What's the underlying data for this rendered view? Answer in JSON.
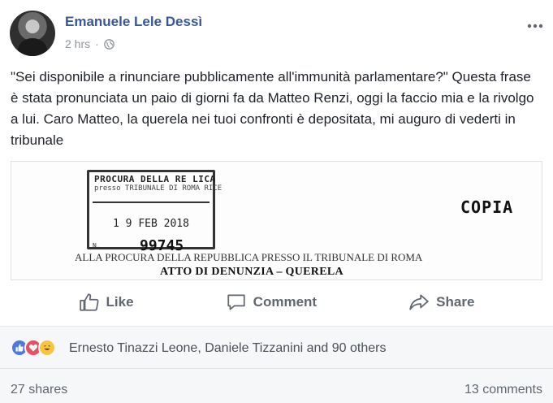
{
  "post": {
    "author": "Emanuele Lele Dessì",
    "time": "2 hrs",
    "dot": "·",
    "audience_icon": "globe-icon",
    "text": "\"Sei disponibile a rinunciare pubblicamente all'immunità parlamentare?\" Questa frase è stata pronunciata un paio di giorni fa da Matteo Renzi, oggi la faccio mia e la rivolgo a lui. Caro Matteo, la querela nei tuoi confronti è depositata, mi auguro di vederti in tribunale"
  },
  "document": {
    "stamp_top": "PROCURA DELLA RE    LICA",
    "stamp_sub": "presso TRIBUNALE DI ROMA  RICE",
    "stamp_date": "1 9 FEB 2018",
    "stamp_n": "N.",
    "stamp_number": "99745",
    "copia": "COPIA",
    "line1": "ALLA PROCURA DELLA REPUBBLICA PRESSO IL TRIBUNALE DI ROMA",
    "line2": "ATTO DI DENUNZIA – QUERELA"
  },
  "actions": {
    "like": "Like",
    "comment": "Comment",
    "share": "Share"
  },
  "reactions": {
    "icons": [
      "like-icon",
      "love-icon",
      "haha-icon"
    ],
    "names": "Ernesto Tinazzi Leone, Daniele Tizzanini and 90 others",
    "shares": "27 shares",
    "comments": "13 comments"
  },
  "colors": {
    "author": "#365899",
    "like": "#4c7bd9",
    "love": "#e9505f",
    "haha": "#f6c542"
  }
}
